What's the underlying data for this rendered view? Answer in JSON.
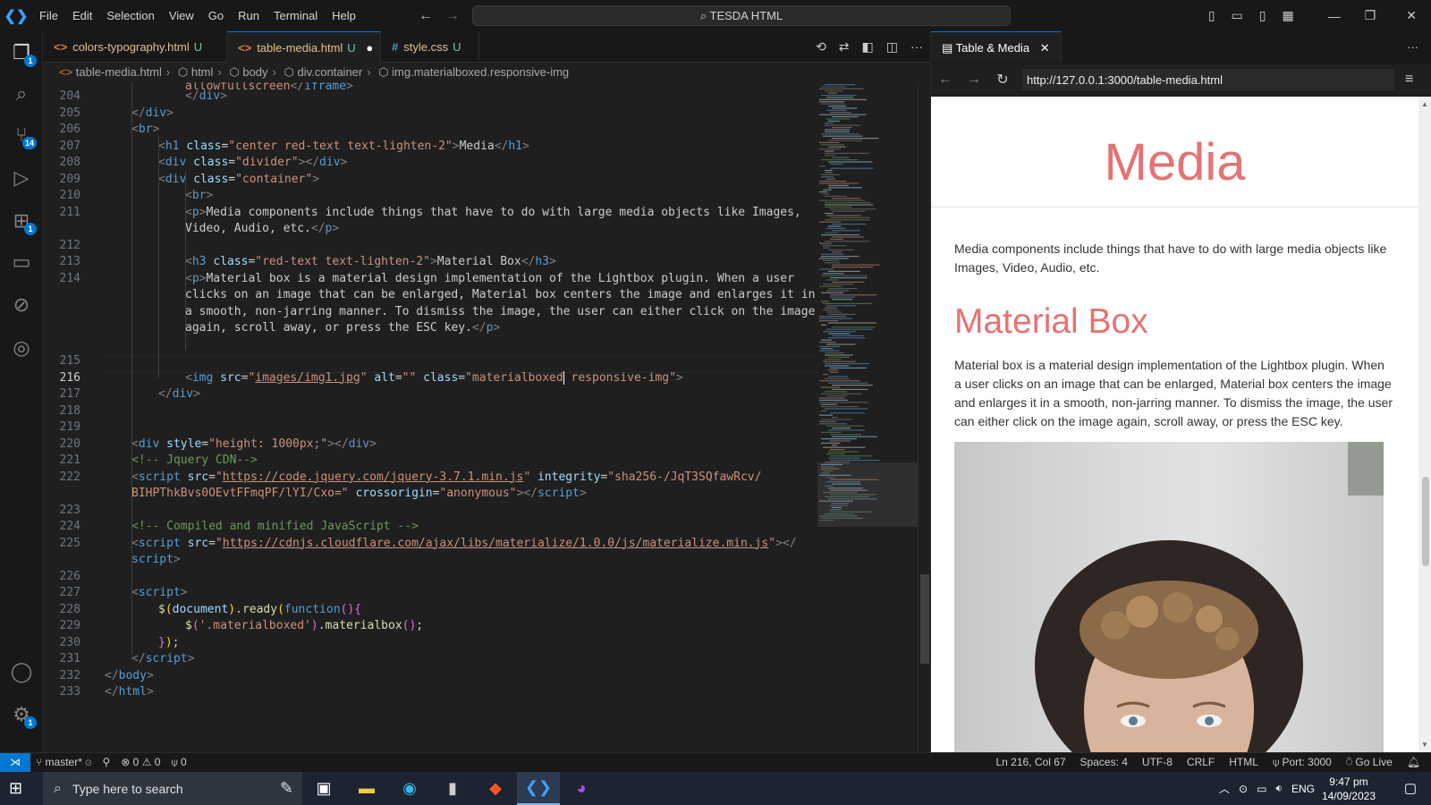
{
  "titlebar": {
    "menus": [
      "File",
      "Edit",
      "Selection",
      "View",
      "Go",
      "Run",
      "Terminal",
      "Help"
    ],
    "search_label": "TESDA HTML"
  },
  "activity_bar": {
    "badges": {
      "explorer": "1",
      "scm": "14",
      "extensions": "1",
      "settings": "1"
    }
  },
  "editor": {
    "tabs": [
      {
        "label": "colors-typography.html",
        "status": "U",
        "active": false
      },
      {
        "label": "table-media.html",
        "status": "U",
        "active": true
      },
      {
        "label": "style.css",
        "status": "U",
        "active": false
      }
    ],
    "breadcrumb": [
      "table-media.html",
      "html",
      "body",
      "div.container",
      "img.materialboxed.responsive-img"
    ],
    "line_numbers": [
      "204",
      "205",
      "206",
      "207",
      "208",
      "209",
      "210",
      "211",
      "212",
      "213",
      "214",
      "215",
      "216",
      "217",
      "218",
      "219",
      "220",
      "221",
      "222",
      "223",
      "224",
      "225",
      "226",
      "227",
      "228",
      "229",
      "230",
      "231",
      "232",
      "233"
    ],
    "current_line": "216"
  },
  "browser": {
    "tab_label": "Table & Media",
    "url": "http://127.0.0.1:3000/table-media.html",
    "page": {
      "title": "Media",
      "intro": "Media components include things that have to do with large media objects like Images, Video, Audio, etc.",
      "section_title": "Material Box",
      "section_text": "Material box is a material design implementation of the Lightbox plugin. When a user clicks on an image that can be enlarged, Material box centers the image and enlarges it in a smooth, non-jarring manner. To dismiss the image, the user can either click on the image again, scroll away, or press the ESC key."
    }
  },
  "statusbar": {
    "branch": "master*",
    "errors": "0",
    "warnings": "0",
    "ports": "0",
    "position": "Ln 216, Col 67",
    "spaces": "Spaces: 4",
    "encoding": "UTF-8",
    "eol": "CRLF",
    "language": "HTML",
    "port": "Port: 3000",
    "golive": "Go Live"
  },
  "taskbar": {
    "search_placeholder": "Type here to search",
    "language": "ENG",
    "time": "9:47 pm",
    "date": "14/09/2023"
  },
  "colors": {
    "accent": "#0078d4",
    "page_heading": "#e57373"
  }
}
